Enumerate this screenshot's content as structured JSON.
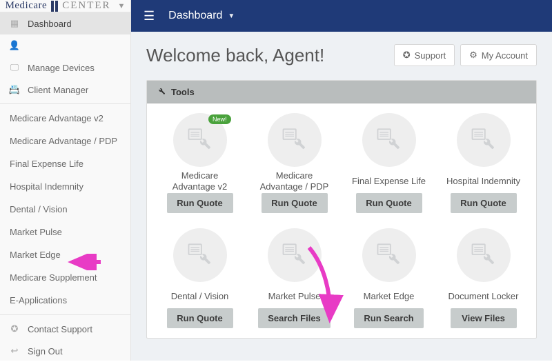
{
  "brand": {
    "part1": "Medicare",
    "part2": "CENTER"
  },
  "sidebar": {
    "primary": [
      {
        "label": "Dashboard",
        "iconGlyph": "▦"
      },
      {
        "label": "",
        "iconGlyph": "👤"
      },
      {
        "label": "Manage Devices",
        "iconGlyph": "🖵"
      },
      {
        "label": "Client Manager",
        "iconGlyph": "📇"
      }
    ],
    "secondary": [
      {
        "label": "Medicare Advantage v2"
      },
      {
        "label": "Medicare Advantage / PDP"
      },
      {
        "label": "Final Expense Life"
      },
      {
        "label": "Hospital Indemnity"
      },
      {
        "label": "Dental / Vision"
      },
      {
        "label": "Market Pulse"
      },
      {
        "label": "Market Edge"
      },
      {
        "label": "Medicare Supplement"
      },
      {
        "label": "E-Applications"
      }
    ],
    "footer": [
      {
        "label": "Contact Support",
        "iconGlyph": "✪"
      },
      {
        "label": "Sign Out",
        "iconGlyph": "↩"
      }
    ]
  },
  "topbar": {
    "title": "Dashboard"
  },
  "header": {
    "welcome": "Welcome back, Agent!",
    "supportLabel": "Support",
    "accountLabel": "My Account"
  },
  "toolsPanel": {
    "title": "Tools",
    "newBadge": "New!",
    "tiles": [
      {
        "label": "Medicare Advantage v2",
        "button": "Run Quote",
        "new": true
      },
      {
        "label": "Medicare Advantage / PDP",
        "button": "Run Quote"
      },
      {
        "label": "Final Expense Life",
        "button": "Run Quote"
      },
      {
        "label": "Hospital Indemnity",
        "button": "Run Quote"
      },
      {
        "label": "Dental / Vision",
        "button": "Run Quote"
      },
      {
        "label": "Market Pulse",
        "button": "Search Files"
      },
      {
        "label": "Market Edge",
        "button": "Run Search"
      },
      {
        "label": "Document Locker",
        "button": "View Files"
      }
    ]
  }
}
